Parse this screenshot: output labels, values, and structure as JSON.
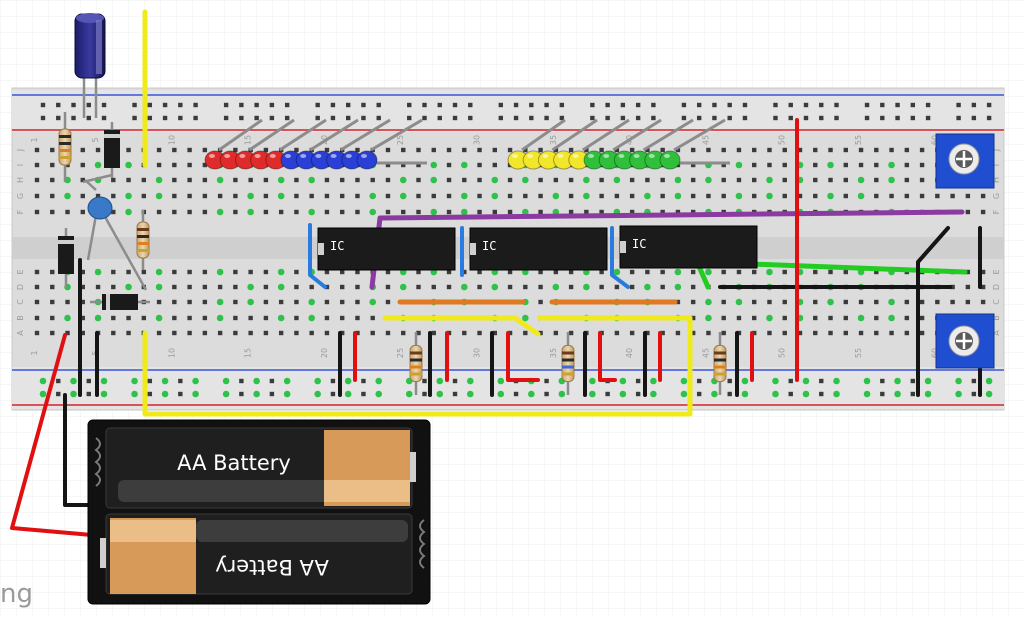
{
  "canvas": {
    "watermark": "ng"
  },
  "breadboard": {
    "row_letters_top": [
      "J",
      "I",
      "H",
      "G",
      "F"
    ],
    "row_letters_bottom": [
      "E",
      "D",
      "C",
      "B",
      "A"
    ],
    "column_numbers": [
      "1",
      "5",
      "10",
      "15",
      "20",
      "25",
      "30",
      "35",
      "40",
      "45",
      "50",
      "55",
      "60"
    ]
  },
  "chips": [
    {
      "label": "IC"
    },
    {
      "label": "IC"
    },
    {
      "label": "IC"
    }
  ],
  "battery_pack": {
    "cell_top_label": "AA Battery",
    "cell_bottom_label": "AA Battery"
  },
  "leds": {
    "group_left_colors": [
      "#e02b2b",
      "#e02b2b",
      "#e02b2b",
      "#e02b2b",
      "#e02b2b",
      "#2a3fd6",
      "#2a3fd6",
      "#2a3fd6",
      "#2a3fd6",
      "#2a3fd6",
      "#2a3fd6"
    ],
    "group_right_colors": [
      "#f2e62a",
      "#f2e62a",
      "#f2e62a",
      "#f2e62a",
      "#f2e62a",
      "#2fbf3a",
      "#2fbf3a",
      "#2fbf3a",
      "#2fbf3a",
      "#2fbf3a",
      "#2fbf3a"
    ]
  },
  "colors": {
    "rail_red": "#d8202a",
    "rail_blue": "#3a55d8",
    "wire_yellow": "#f0ea1a",
    "wire_red": "#e01010",
    "wire_black": "#151515",
    "wire_green": "#22cc22",
    "wire_purple": "#8a3aa0",
    "wire_orange": "#e07a22",
    "wire_blue": "#2a7be0",
    "pot_blue": "#1f4fd0",
    "hole_green": "#2fc24a"
  }
}
